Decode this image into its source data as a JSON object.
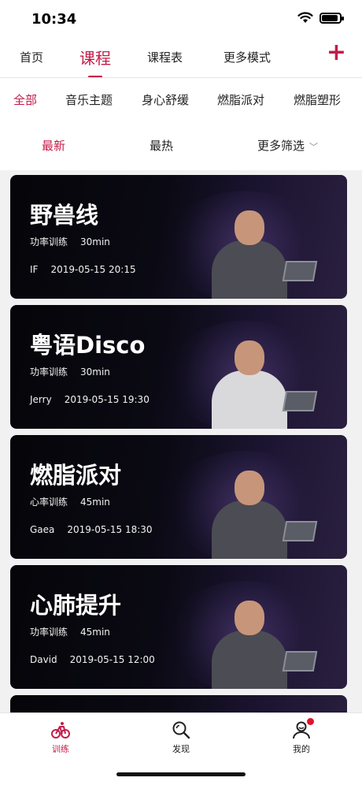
{
  "status_bar": {
    "time": "10:34"
  },
  "top_tabs": [
    {
      "label": "首页"
    },
    {
      "label": "课程",
      "active": true
    },
    {
      "label": "课程表"
    },
    {
      "label": "更多模式"
    }
  ],
  "add_button": "+",
  "category_tabs": [
    {
      "label": "全部",
      "active": true
    },
    {
      "label": "音乐主题"
    },
    {
      "label": "身心舒缓"
    },
    {
      "label": "燃脂派对"
    },
    {
      "label": "燃脂塑形"
    }
  ],
  "sort": {
    "latest": "最新",
    "hottest": "最热",
    "more_filters": "更多筛选"
  },
  "courses": [
    {
      "title": "野兽线",
      "type": "功率训练",
      "duration": "30min",
      "coach": "IF",
      "datetime": "2019-05-15 20:15"
    },
    {
      "title": "粤语Disco",
      "type": "功率训练",
      "duration": "30min",
      "coach": "Jerry",
      "datetime": "2019-05-15 19:30"
    },
    {
      "title": "燃脂派对",
      "type": "心率训练",
      "duration": "45min",
      "coach": "Gaea",
      "datetime": "2019-05-15 18:30"
    },
    {
      "title": "心肺提升",
      "type": "功率训练",
      "duration": "45min",
      "coach": "David",
      "datetime": "2019-05-15 12:00"
    }
  ],
  "bottom_nav": [
    {
      "label": "训练",
      "icon": "cycling-icon",
      "active": true
    },
    {
      "label": "发现",
      "icon": "discover-search-icon"
    },
    {
      "label": "我的",
      "icon": "profile-icon",
      "badge": true
    }
  ],
  "colors": {
    "accent": "#c41b4a",
    "badge": "#e3122d"
  }
}
